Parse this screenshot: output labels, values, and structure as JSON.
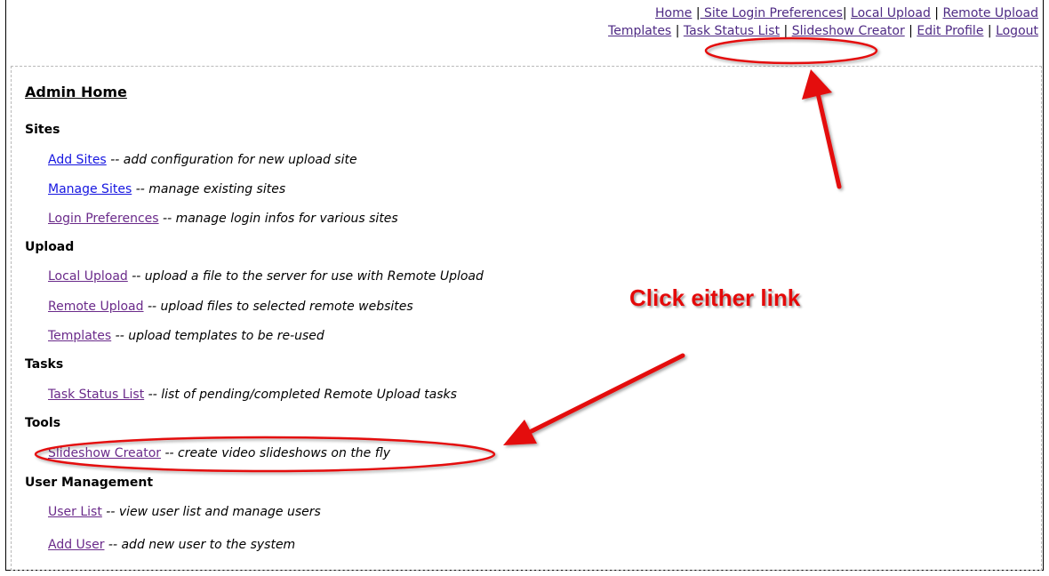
{
  "top_nav": {
    "row1": [
      "Home",
      " Site Login Preferences",
      "Local Upload",
      "Remote Upload"
    ],
    "row2": [
      "Templates",
      "Task Status List",
      "Slideshow Creator",
      "Edit Profile",
      "Logout"
    ],
    "separator": "|"
  },
  "page_title": "Admin Home",
  "sections": [
    {
      "heading": "Sites",
      "items": [
        {
          "link": "Add Sites",
          "desc": "-- add configuration for new upload site"
        },
        {
          "link": "Manage Sites",
          "desc": "-- manage existing sites"
        },
        {
          "link": "Login Preferences",
          "desc": "-- manage login infos for various sites"
        }
      ]
    },
    {
      "heading": "Upload",
      "items": [
        {
          "link": "Local Upload",
          "desc": "-- upload a file to the server for use with Remote Upload"
        },
        {
          "link": "Remote Upload",
          "desc": "-- upload files to selected remote websites"
        },
        {
          "link": "Templates",
          "desc": "-- upload templates to be re-used"
        }
      ]
    },
    {
      "heading": "Tasks",
      "items": [
        {
          "link": "Task Status List",
          "desc": "-- list of pending/completed Remote Upload tasks"
        }
      ]
    },
    {
      "heading": "Tools",
      "items": [
        {
          "link": "Slideshow Creator",
          "desc": "-- create video slideshows on the fly"
        }
      ]
    },
    {
      "heading": "User Management",
      "items": [
        {
          "link": "User List",
          "desc": "-- view user list and manage users"
        },
        {
          "link": "Add User",
          "desc": "-- add new user to the system"
        }
      ]
    }
  ],
  "annotation": {
    "text": "Click either link",
    "color": "#e40a0a"
  }
}
